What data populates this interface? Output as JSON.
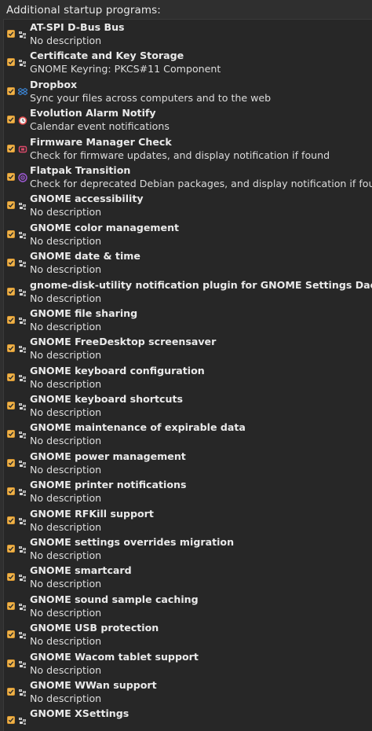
{
  "header": {
    "title": "Additional startup programs:"
  },
  "items": [
    {
      "name": "AT-SPI D-Bus Bus",
      "description": "No description",
      "icon": "generic-executable-icon",
      "checked": true
    },
    {
      "name": "Certificate and Key Storage",
      "description": "GNOME Keyring: PKCS#11 Component",
      "icon": "generic-executable-icon",
      "checked": true
    },
    {
      "name": "Dropbox",
      "description": "Sync your files across computers and to the web",
      "icon": "dropbox-icon",
      "checked": true
    },
    {
      "name": "Evolution Alarm Notify",
      "description": "Calendar event notifications",
      "icon": "alarm-clock-icon",
      "checked": true
    },
    {
      "name": "Firmware Manager Check",
      "description": "Check for firmware updates, and display notification if found",
      "icon": "firmware-chip-icon",
      "checked": true
    },
    {
      "name": "Flatpak Transition",
      "description": "Check for deprecated Debian packages, and display notification if found",
      "icon": "flatpak-icon",
      "checked": true
    },
    {
      "name": "GNOME accessibility",
      "description": "No description",
      "icon": "generic-executable-icon",
      "checked": true
    },
    {
      "name": "GNOME color management",
      "description": "No description",
      "icon": "generic-executable-icon",
      "checked": true
    },
    {
      "name": "GNOME date & time",
      "description": "No description",
      "icon": "generic-executable-icon",
      "checked": true
    },
    {
      "name": "gnome-disk-utility notification plugin for GNOME Settings Daemon",
      "description": "No description",
      "icon": "generic-executable-icon",
      "checked": true
    },
    {
      "name": "GNOME file sharing",
      "description": "No description",
      "icon": "generic-executable-icon",
      "checked": true
    },
    {
      "name": "GNOME FreeDesktop screensaver",
      "description": "No description",
      "icon": "generic-executable-icon",
      "checked": true
    },
    {
      "name": "GNOME keyboard configuration",
      "description": "No description",
      "icon": "generic-executable-icon",
      "checked": true
    },
    {
      "name": "GNOME keyboard shortcuts",
      "description": "No description",
      "icon": "generic-executable-icon",
      "checked": true
    },
    {
      "name": "GNOME maintenance of expirable data",
      "description": "No description",
      "icon": "generic-executable-icon",
      "checked": true
    },
    {
      "name": "GNOME power management",
      "description": "No description",
      "icon": "generic-executable-icon",
      "checked": true
    },
    {
      "name": "GNOME printer notifications",
      "description": "No description",
      "icon": "generic-executable-icon",
      "checked": true
    },
    {
      "name": "GNOME RFKill support",
      "description": "No description",
      "icon": "generic-executable-icon",
      "checked": true
    },
    {
      "name": "GNOME settings overrides migration",
      "description": "No description",
      "icon": "generic-executable-icon",
      "checked": true
    },
    {
      "name": "GNOME smartcard",
      "description": "No description",
      "icon": "generic-executable-icon",
      "checked": true
    },
    {
      "name": "GNOME sound sample caching",
      "description": "No description",
      "icon": "generic-executable-icon",
      "checked": true
    },
    {
      "name": "GNOME USB protection",
      "description": "No description",
      "icon": "generic-executable-icon",
      "checked": true
    },
    {
      "name": "GNOME Wacom tablet support",
      "description": "No description",
      "icon": "generic-executable-icon",
      "checked": true
    },
    {
      "name": "GNOME WWan support",
      "description": "No description",
      "icon": "generic-executable-icon",
      "checked": true
    },
    {
      "name": "GNOME XSettings",
      "description": "",
      "icon": "generic-executable-icon",
      "checked": true
    }
  ],
  "colors": {
    "background": "#2f2f2f",
    "list_background": "#272727",
    "checkbox": "#f0b34a",
    "dropbox": "#3d8fe8",
    "alarm": "#e04a4a",
    "firmware": "#d94a6a",
    "flatpak": "#a05ad8"
  }
}
